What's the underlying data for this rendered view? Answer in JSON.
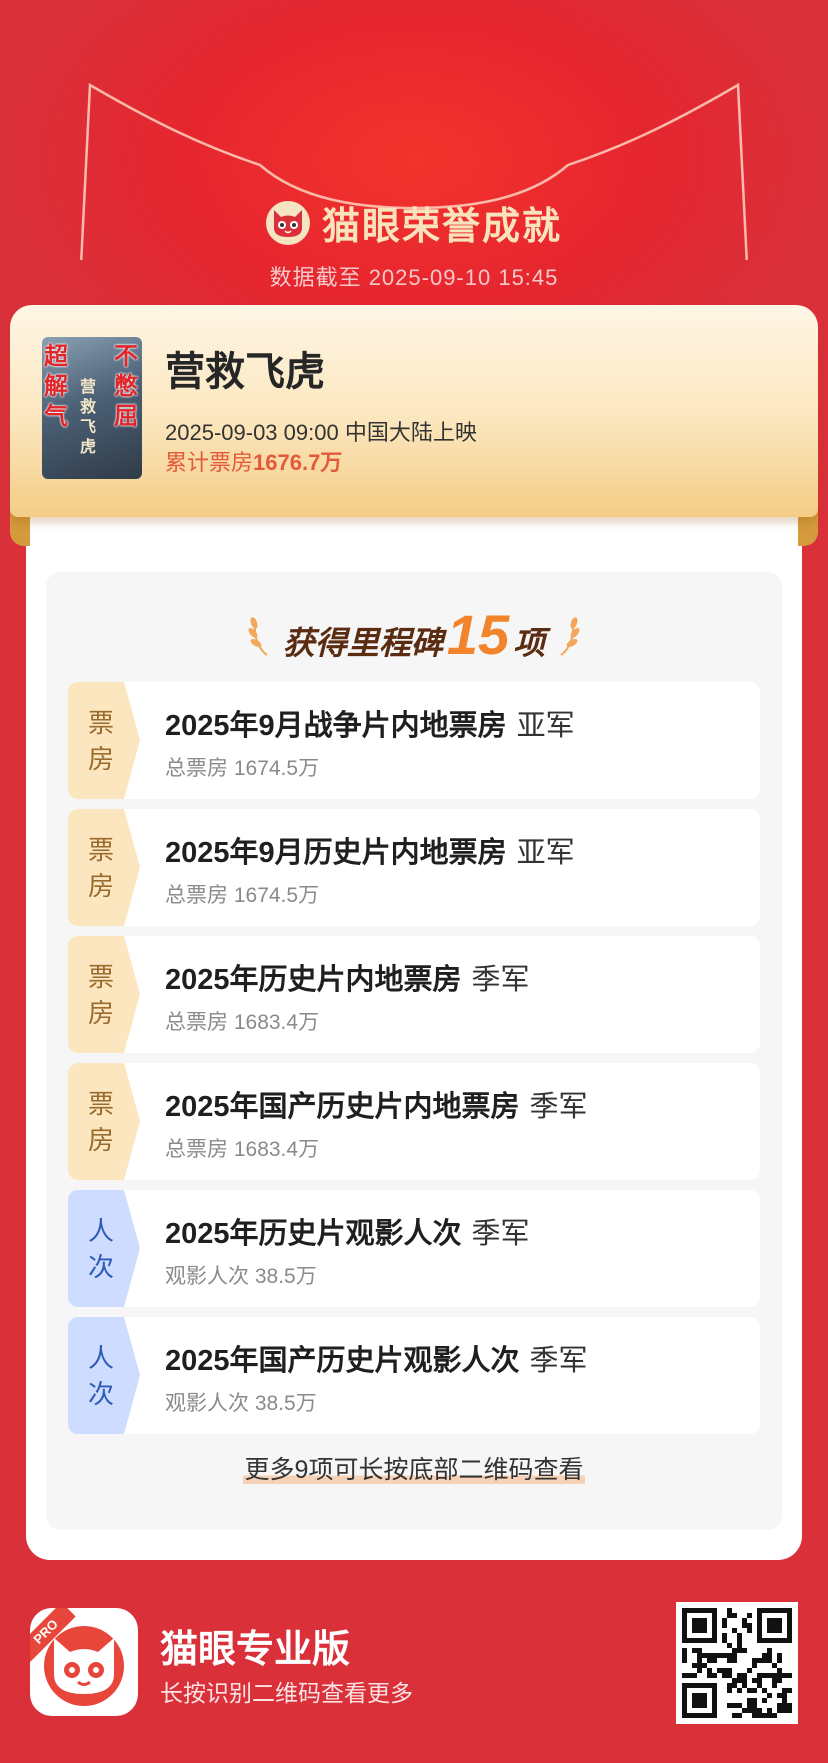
{
  "header": {
    "brand_title": "猫眼荣誉成就",
    "data_time": "数据截至 2025-09-10 15:45",
    "logo_icon": "cat-face-icon"
  },
  "movie": {
    "title": "营救飞虎",
    "release": "2025-09-03 09:00 中国大陆上映",
    "boxoffice_label": "累计票房",
    "boxoffice_value": "1676.7万",
    "poster": {
      "left_text": "超解气",
      "right_text": "不憋屈",
      "center_text": "营救飞虎"
    }
  },
  "milestones": {
    "heading_prefix": "获得里程碑",
    "count": "15",
    "heading_suffix": "项",
    "items": [
      {
        "tag": "票房",
        "type": "box",
        "title": "2025年9月战争片内地票房",
        "rank": "亚军",
        "sub": "总票房 1674.5万"
      },
      {
        "tag": "票房",
        "type": "box",
        "title": "2025年9月历史片内地票房",
        "rank": "亚军",
        "sub": "总票房 1674.5万"
      },
      {
        "tag": "票房",
        "type": "box",
        "title": "2025年历史片内地票房",
        "rank": "季军",
        "sub": "总票房 1683.4万"
      },
      {
        "tag": "票房",
        "type": "box",
        "title": "2025年国产历史片内地票房",
        "rank": "季军",
        "sub": "总票房 1683.4万"
      },
      {
        "tag": "人次",
        "type": "people",
        "title": "2025年历史片观影人次",
        "rank": "季军",
        "sub": "观影人次 38.5万"
      },
      {
        "tag": "人次",
        "type": "people",
        "title": "2025年国产历史片观影人次",
        "rank": "季军",
        "sub": "观影人次 38.5万"
      }
    ],
    "more_text": "更多9项可长按底部二维码查看"
  },
  "footer": {
    "app_name": "猫眼专业版",
    "hint": "长按识别二维码查看更多",
    "pro_badge": "PRO",
    "logo_icon": "cat-face-icon",
    "qr_icon": "qr-code-icon"
  },
  "colors": {
    "background": "#d9303a",
    "accent_gold": "#f9e3bc",
    "boxoffice_red": "#e25a3a",
    "count_orange": "#f2842b",
    "tag_box_bg": "#fbe6bf",
    "tag_people_bg": "#cddcff"
  }
}
